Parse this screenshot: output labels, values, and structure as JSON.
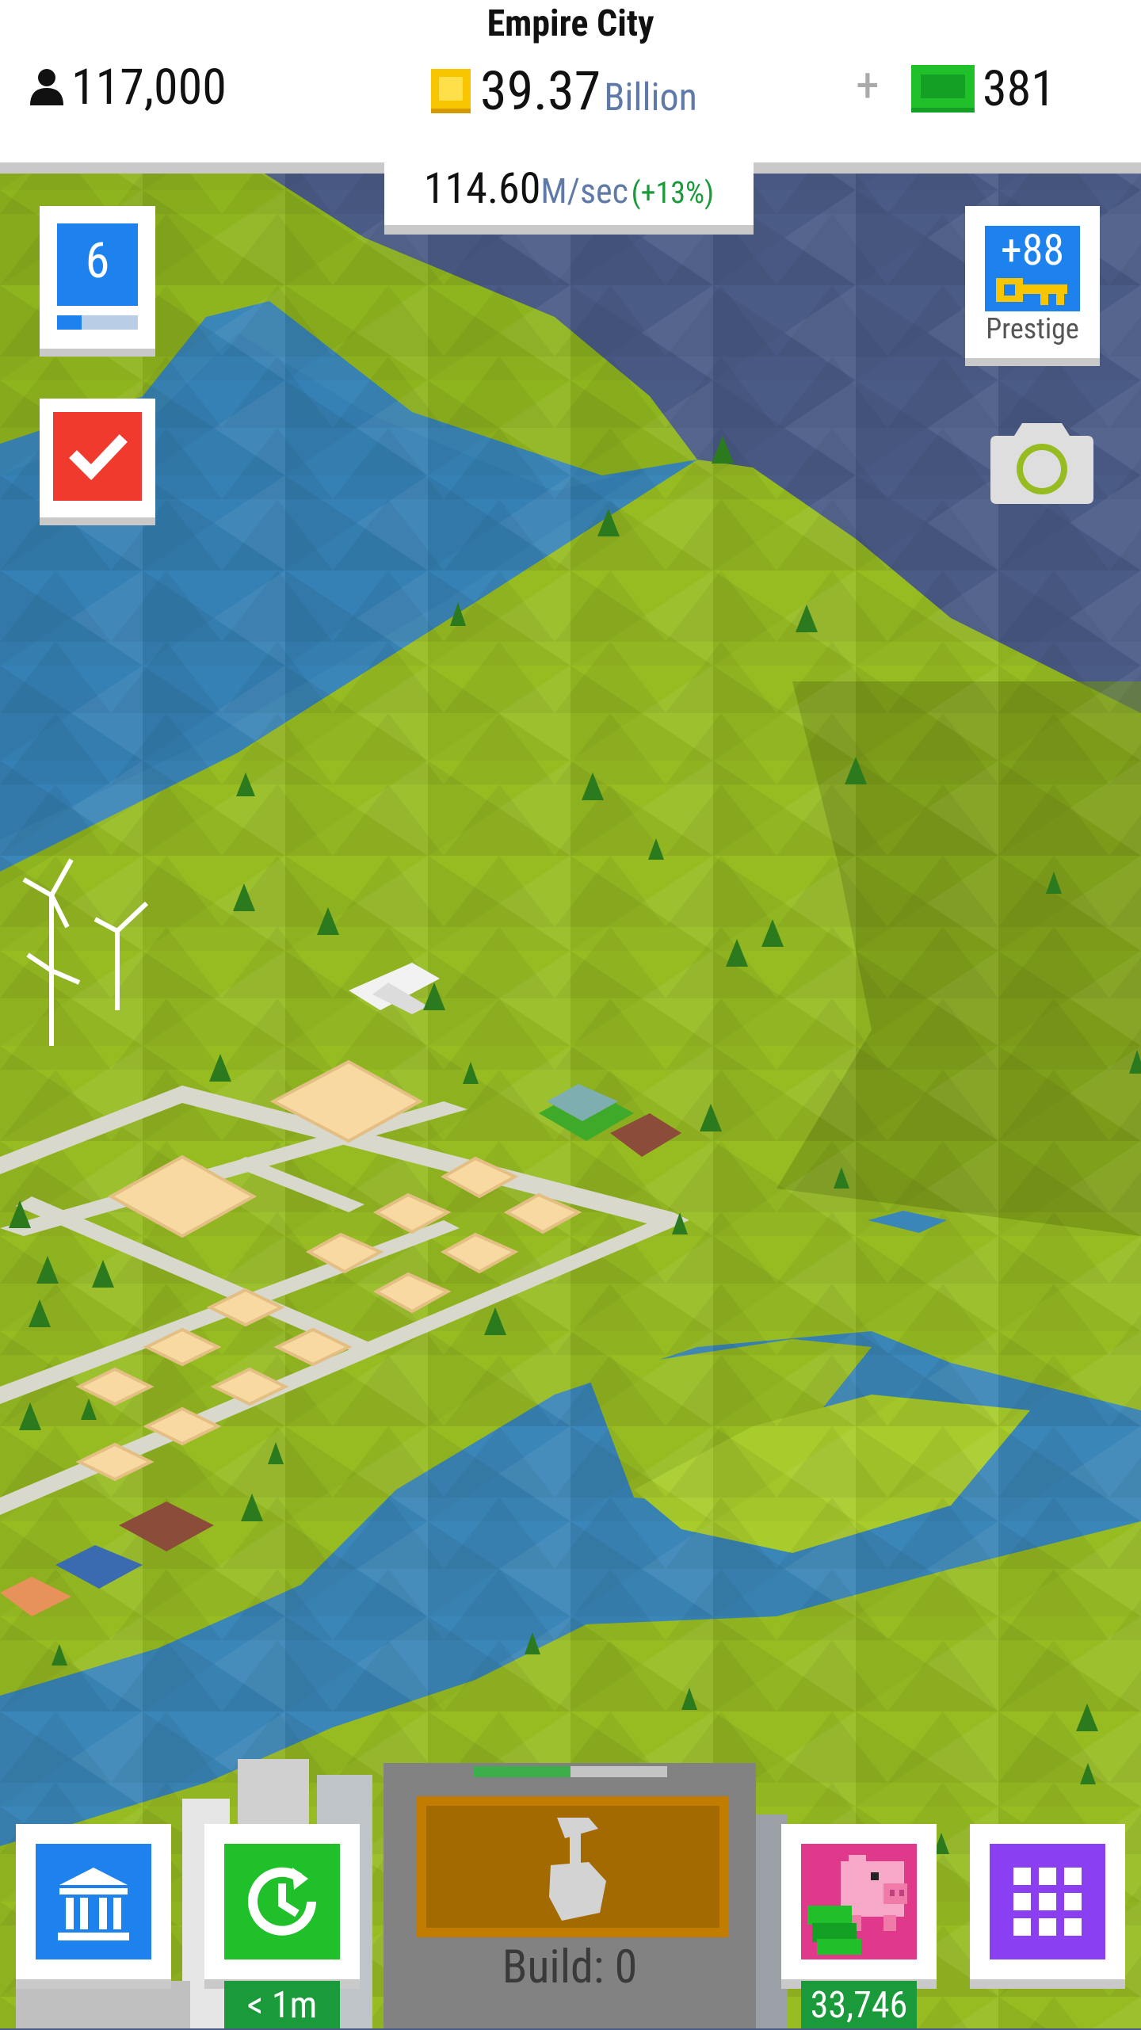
{
  "header": {
    "city_name": "Empire City",
    "population": "117,000",
    "money_amount": "39.37",
    "money_unit": "Billion",
    "plus": "+",
    "cash": "381"
  },
  "income": {
    "value": "114.60",
    "unit": "M/sec",
    "bonus": "(+13%)"
  },
  "level": {
    "number": "6",
    "progress": 0.3
  },
  "prestige": {
    "keys": "+88",
    "label": "Prestige"
  },
  "build": {
    "label": "Build: 0",
    "progress": 0.5
  },
  "boost": {
    "label": "< 1m"
  },
  "piggy": {
    "label": "33,746"
  },
  "icons": {
    "population": "person-icon",
    "money": "coin-icon",
    "cash": "cash-icon",
    "tasks": "checkmark-icon",
    "prestige": "key-icon",
    "camera": "camera-icon",
    "bank": "bank-icon",
    "boost": "clock-icon",
    "build": "hammer-icon",
    "piggy": "piggy-bank-icon",
    "menu": "grid-icon"
  },
  "colors": {
    "blue": "#1e82ee",
    "green": "#1fc02a",
    "red": "#f03a2e",
    "pink": "#e0388a",
    "purple": "#8a3ff0",
    "gold": "#f7c600"
  }
}
